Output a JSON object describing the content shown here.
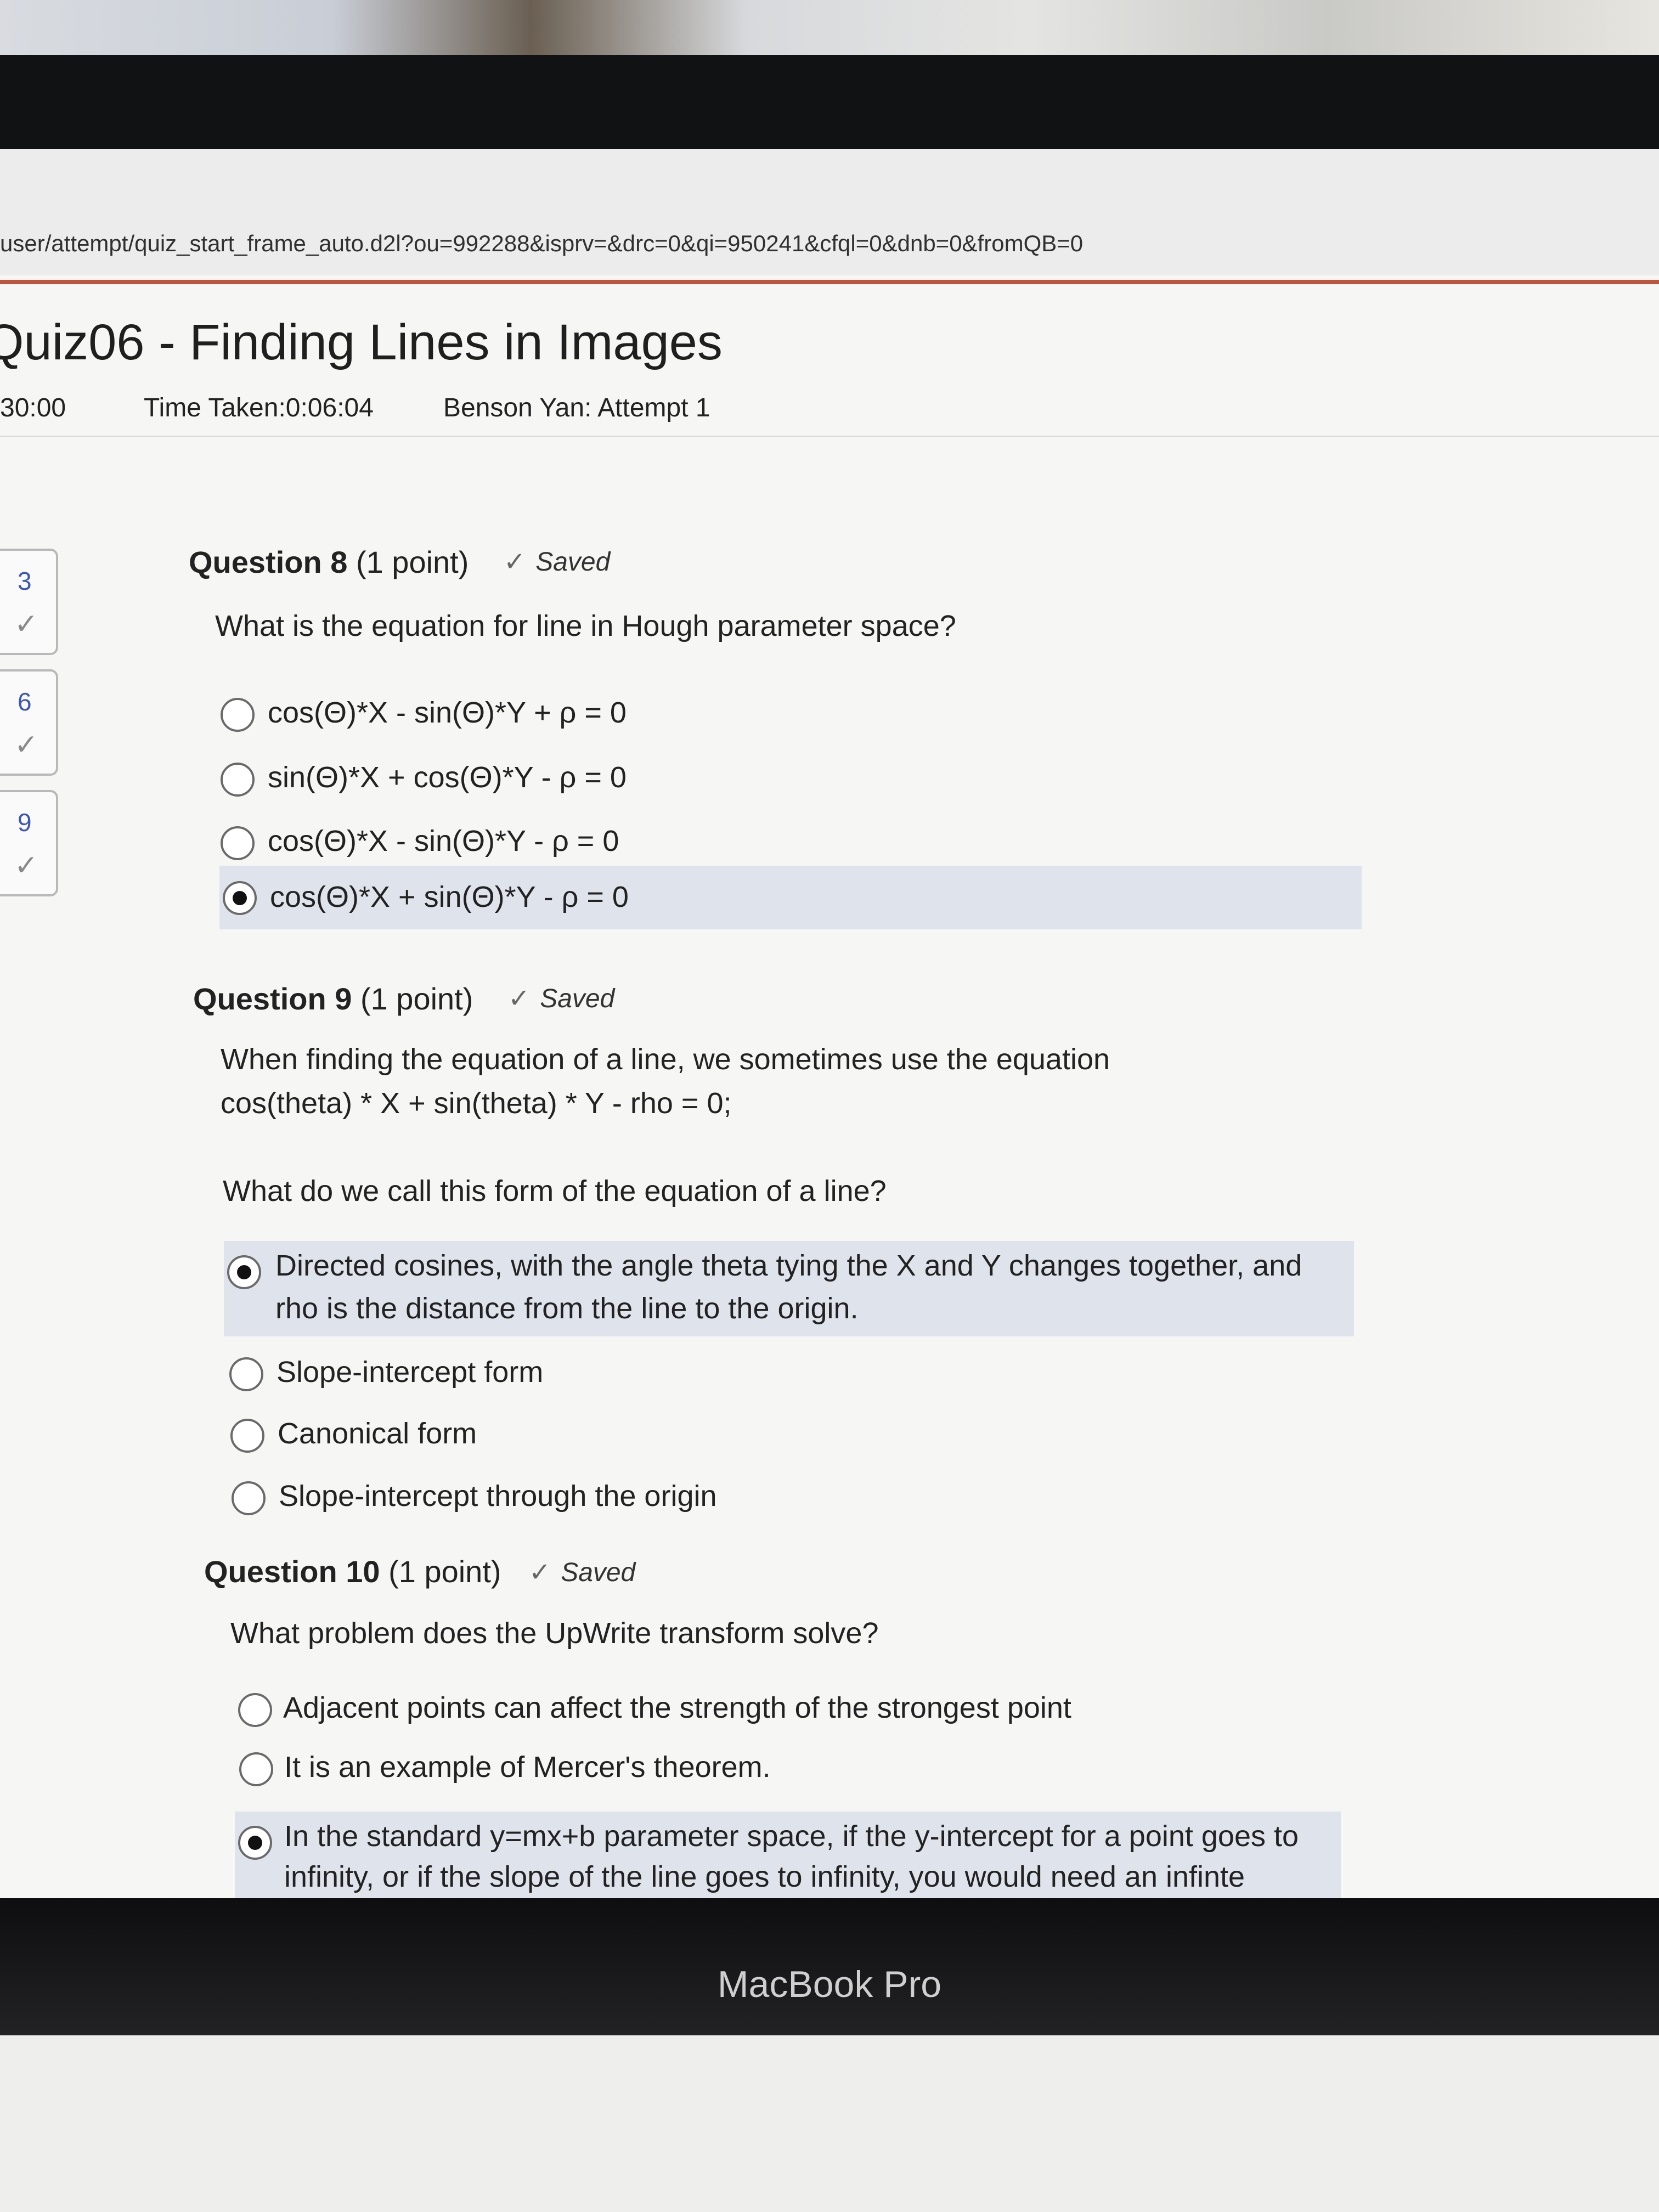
{
  "browser": {
    "url": "user/attempt/quiz_start_frame_auto.d2l?ou=992288&isprv=&drc=0&qi=950241&cfql=0&dnb=0&fromQB=0"
  },
  "quiz": {
    "title": "Quiz06 - Finding Lines in Images",
    "time_limit": "30:00",
    "time_taken": "Time Taken:0:06:04",
    "attempt": "Benson Yan: Attempt 1"
  },
  "sidebar": {
    "items": [
      {
        "number": "3",
        "check": "✓"
      },
      {
        "number": "6",
        "check": "✓"
      },
      {
        "number": "9",
        "check": "✓"
      }
    ]
  },
  "questions": [
    {
      "title": "Question 8",
      "points": "(1 point)",
      "status": "Saved",
      "prompt": [
        "What is the equation for line in Hough parameter space?"
      ],
      "options": [
        {
          "text": [
            "cos(Θ)*X - sin(Θ)*Y + ρ = 0"
          ],
          "selected": false
        },
        {
          "text": [
            "sin(Θ)*X + cos(Θ)*Y - ρ = 0"
          ],
          "selected": false
        },
        {
          "text": [
            "cos(Θ)*X - sin(Θ)*Y - ρ = 0"
          ],
          "selected": false
        },
        {
          "text": [
            "cos(Θ)*X + sin(Θ)*Y - ρ = 0"
          ],
          "selected": true
        }
      ]
    },
    {
      "title": "Question 9",
      "points": "(1 point)",
      "status": "Saved",
      "prompt": [
        "When finding the equation of a line, we sometimes use the equation",
        "cos(theta) * X + sin(theta) * Y - rho = 0;",
        "What do we call this form of the equation of a line?"
      ],
      "options": [
        {
          "text": [
            "Directed cosines, with the angle theta tying the X and Y changes together, and",
            "rho is the distance from the line to the origin."
          ],
          "selected": true
        },
        {
          "text": [
            "Slope-intercept form"
          ],
          "selected": false
        },
        {
          "text": [
            "Canonical form"
          ],
          "selected": false
        },
        {
          "text": [
            "Slope-intercept through the origin"
          ],
          "selected": false
        }
      ]
    },
    {
      "title": "Question 10",
      "points": "(1 point)",
      "status": "Saved",
      "prompt": [
        "What problem does the UpWrite transform solve?"
      ],
      "options": [
        {
          "text": [
            "Adjacent points can affect the strength of the strongest point"
          ],
          "selected": false
        },
        {
          "text": [
            "It is an example of Mercer's theorem."
          ],
          "selected": false
        },
        {
          "text": [
            "In the standard y=mx+b parameter space, if the y-intercept for a point goes to",
            "infinity, or if the slope of the line goes to infinity, you would need an infinte"
          ],
          "selected": true
        }
      ]
    }
  ],
  "device": {
    "brand": "MacBook Pro"
  }
}
